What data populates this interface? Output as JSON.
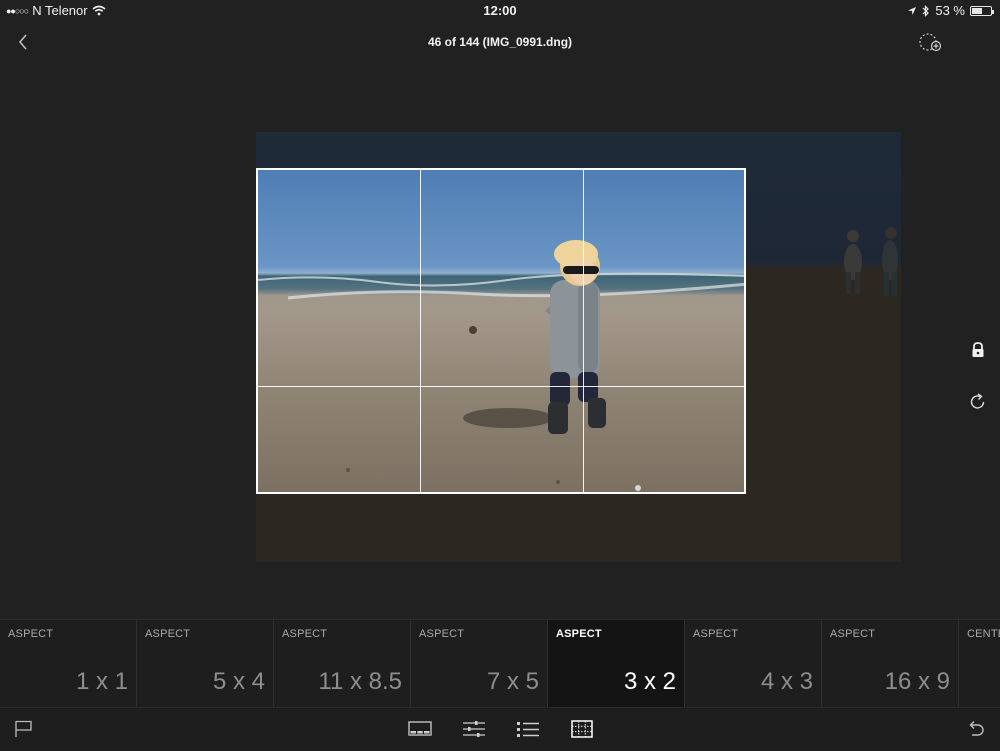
{
  "status": {
    "carrier": "N Telenor",
    "time": "12:00",
    "battery": "53 %",
    "battery_level": 0.53,
    "icons": [
      "signal-dots",
      "wifi-icon",
      "location-icon",
      "bluetooth-icon",
      "battery-icon"
    ]
  },
  "header": {
    "title": "46 of 144 (IMG_0991.dng)",
    "back_icon": "chevron-left-icon",
    "add_icon": "add-to-collection-icon"
  },
  "side_tools": [
    "lock-icon",
    "rotate-icon"
  ],
  "aspects": [
    {
      "caption": "ASPECT",
      "value": "1 x 1"
    },
    {
      "caption": "ASPECT",
      "value": "5 x 4"
    },
    {
      "caption": "ASPECT",
      "value": "11 x 8.5"
    },
    {
      "caption": "ASPECT",
      "value": "7 x 5"
    },
    {
      "caption": "ASPECT",
      "value": "3 x 2",
      "active": true
    },
    {
      "caption": "ASPECT",
      "value": "4 x 3"
    },
    {
      "caption": "ASPECT",
      "value": "16 x 9"
    },
    {
      "caption": "CENTE",
      "value": ""
    }
  ],
  "toolbar": {
    "icons": [
      "flag-icon",
      "filmstrip-icon",
      "adjust-sliders-icon",
      "presets-list-icon",
      "crop-icon",
      "undo-icon"
    ],
    "active": "crop-icon"
  },
  "colors": {
    "background": "#212121",
    "crop_frame": "#ffffff",
    "active_text": "#ffffff",
    "inactive_text": "#8e8e8e"
  }
}
